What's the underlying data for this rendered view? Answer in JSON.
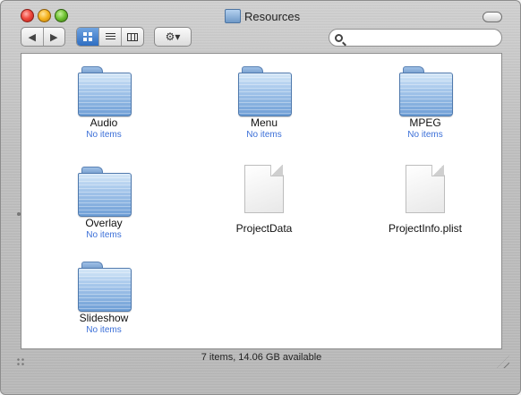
{
  "window": {
    "title": "Resources"
  },
  "toolbar": {
    "back_label": "◀",
    "forward_label": "▶",
    "action_label": "⚙▾",
    "search_placeholder": ""
  },
  "items": [
    {
      "name": "Audio",
      "sub": "No items",
      "type": "folder"
    },
    {
      "name": "Menu",
      "sub": "No items",
      "type": "folder"
    },
    {
      "name": "MPEG",
      "sub": "No items",
      "type": "folder"
    },
    {
      "name": "Overlay",
      "sub": "No items",
      "type": "folder"
    },
    {
      "name": "ProjectData",
      "sub": "",
      "type": "document"
    },
    {
      "name": "ProjectInfo.plist",
      "sub": "",
      "type": "document"
    },
    {
      "name": "Slideshow",
      "sub": "No items",
      "type": "folder"
    }
  ],
  "status": {
    "text": "7 items, 14.06 GB available"
  },
  "colors": {
    "accent": "#3b6fd8",
    "folder_blue": "#6f9fd6"
  }
}
